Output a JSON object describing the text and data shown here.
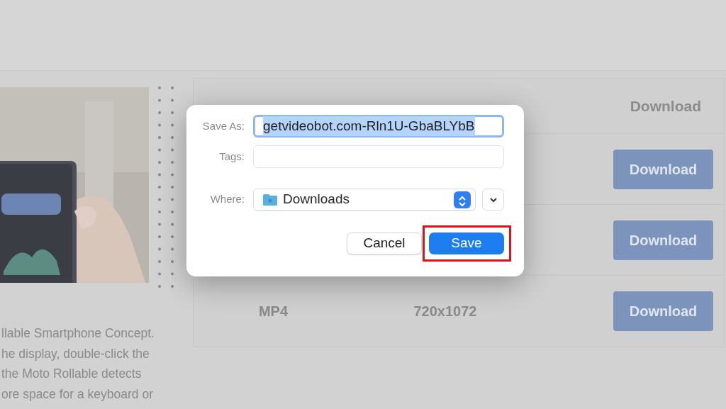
{
  "page": {
    "description_lines": [
      "llable Smartphone Concept.",
      "he display, double-click the",
      "the Moto Rollable detects",
      "ore space for a keyboard or"
    ],
    "table": {
      "visible_header": "Download",
      "rows": [
        {
          "button": "Download"
        },
        {
          "button": "Download"
        },
        {
          "format": "MP4",
          "size": "720x1072",
          "button": "Download"
        }
      ]
    }
  },
  "save_dialog": {
    "save_as": {
      "label": "Save As:",
      "value": "getvideobot.com-Rln1U-GbaBLYbB",
      "text_selected": true
    },
    "tags": {
      "label": "Tags:"
    },
    "where": {
      "label": "Where:",
      "value": "Downloads",
      "expanded": false
    },
    "buttons": [
      {
        "label": "Cancel",
        "kind": "secondary"
      },
      {
        "label": "Save",
        "kind": "primary",
        "highlighted": true
      }
    ]
  }
}
